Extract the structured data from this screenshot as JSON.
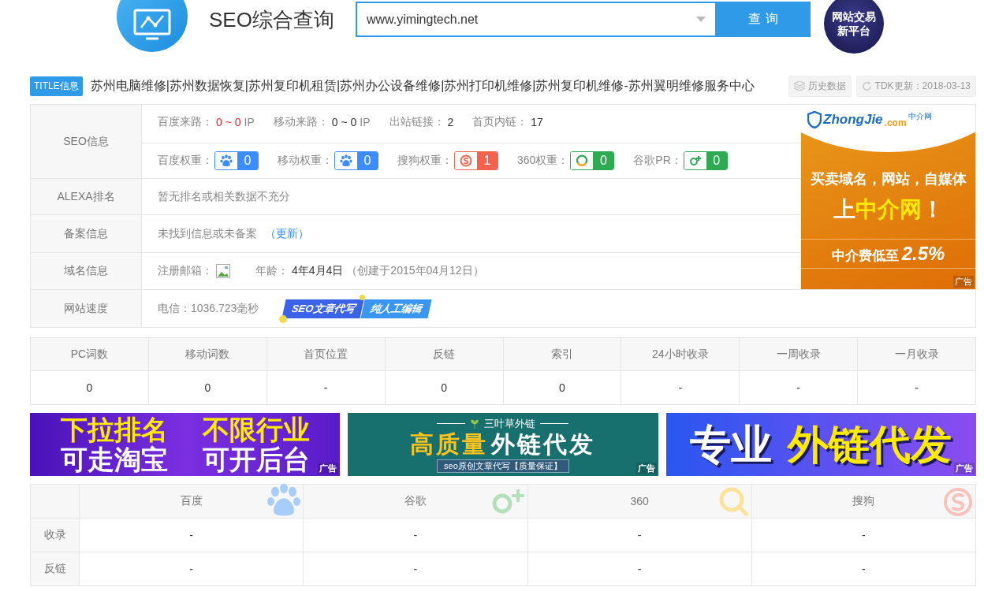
{
  "header": {
    "title": "SEO综合查询",
    "search": {
      "value": "www.yimingtech.net"
    },
    "search_button": "查 询",
    "badge_lines": [
      "网站交易",
      "新平台"
    ]
  },
  "title_bar": {
    "tag": "TITLE信息",
    "text": "苏州电脑维修|苏州数据恢复|苏州复印机租赁|苏州办公设备维修|苏州打印机维修|苏州复印机维修-苏州翼明维修服务中心",
    "history": "历史数据",
    "tdk": "TDK更新：2018-03-13"
  },
  "seo_table": {
    "rows": [
      {
        "kind": "seo",
        "label": "SEO信息",
        "traffic": [
          {
            "label": "百度来路：",
            "value": "0 ~ 0",
            "unit": "IP",
            "alert": true
          },
          {
            "label": "移动来路：",
            "value": "0 ~ 0",
            "unit": "IP",
            "alert": false
          },
          {
            "label": "出站链接：",
            "value": "2",
            "alert": false
          },
          {
            "label": "首页内链：",
            "value": "17",
            "alert": false
          }
        ],
        "weights": [
          {
            "label": "百度权重：",
            "kind": "baidu",
            "value": "0"
          },
          {
            "label": "移动权重：",
            "kind": "mobile",
            "value": "0"
          },
          {
            "label": "搜狗权重：",
            "kind": "sogou",
            "value": "1"
          },
          {
            "label": "360权重：",
            "kind": "ring",
            "value": "0"
          },
          {
            "label": "谷歌PR：",
            "kind": "google",
            "value": "0"
          }
        ]
      },
      {
        "kind": "text",
        "label": "ALEXA排名",
        "text": "暂无排名或相关数据不充分"
      },
      {
        "kind": "beian",
        "label": "备案信息",
        "text": "未找到信息或未备案",
        "link": "（更新）"
      },
      {
        "kind": "domain",
        "label": "域名信息",
        "email_label": "注册邮箱：",
        "age_label": "年龄：",
        "age": "4年4月4日",
        "created": "（创建于2015年04月12日）"
      },
      {
        "kind": "speed",
        "label": "网站速度",
        "text": "电信：1036.723毫秒",
        "promo": [
          "SEO文章代写",
          "纯人工编辑"
        ]
      }
    ],
    "ad": {
      "logo": "ZhongJie",
      "logo_suffix": ".com",
      "logo_cn": "中介网",
      "line": "买卖域名，网站，自媒体",
      "headline": [
        {
          "text": "上",
          "accent": false
        },
        {
          "text": "中介网",
          "accent": true
        },
        {
          "text": "！",
          "accent": false
        }
      ],
      "fee": "中介费低至",
      "rate": "2.5%",
      "ad_mark": "广告"
    }
  },
  "stats": {
    "columns": [
      "PC词数",
      "移动词数",
      "首页位置",
      "反链",
      "索引",
      "24小时收录",
      "一周收录",
      "一月收录"
    ],
    "values": [
      "0",
      "0",
      "-",
      "0",
      "0",
      "-",
      "-",
      "-"
    ]
  },
  "banners": [
    {
      "kind": "purple",
      "rows": [
        [
          {
            "text": "下拉排名",
            "accent": true
          },
          {
            "text": "不限行业",
            "accent": true
          }
        ],
        [
          {
            "text": "可走淘宝",
            "accent": false
          },
          {
            "text": "可开后台",
            "accent": false
          }
        ]
      ],
      "ad_mark": "广告"
    },
    {
      "kind": "teal",
      "caption": "三叶草外链",
      "rows": [
        [
          {
            "text": "高质量",
            "accent": true
          },
          {
            "text": "外链代发",
            "accent": false
          }
        ]
      ],
      "tagline": "seo原创文章代写【质量保证】",
      "ad_mark": "广告"
    },
    {
      "kind": "blue",
      "rows": [
        [
          {
            "text": "专业",
            "accent": false
          },
          {
            "text": "外链代发",
            "accent": true
          }
        ]
      ],
      "ad_mark": "广告"
    }
  ],
  "engines": {
    "columns": [
      {
        "name": "百度",
        "kind": "baidu"
      },
      {
        "name": "谷歌",
        "kind": "google"
      },
      {
        "name": "360",
        "kind": "magnifier"
      },
      {
        "name": "搜狗",
        "kind": "sogou"
      }
    ],
    "rows": [
      {
        "label": "收录",
        "values": [
          "-",
          "-",
          "-",
          "-"
        ]
      },
      {
        "label": "反链",
        "values": [
          "-",
          "-",
          "-",
          "-"
        ]
      }
    ]
  }
}
